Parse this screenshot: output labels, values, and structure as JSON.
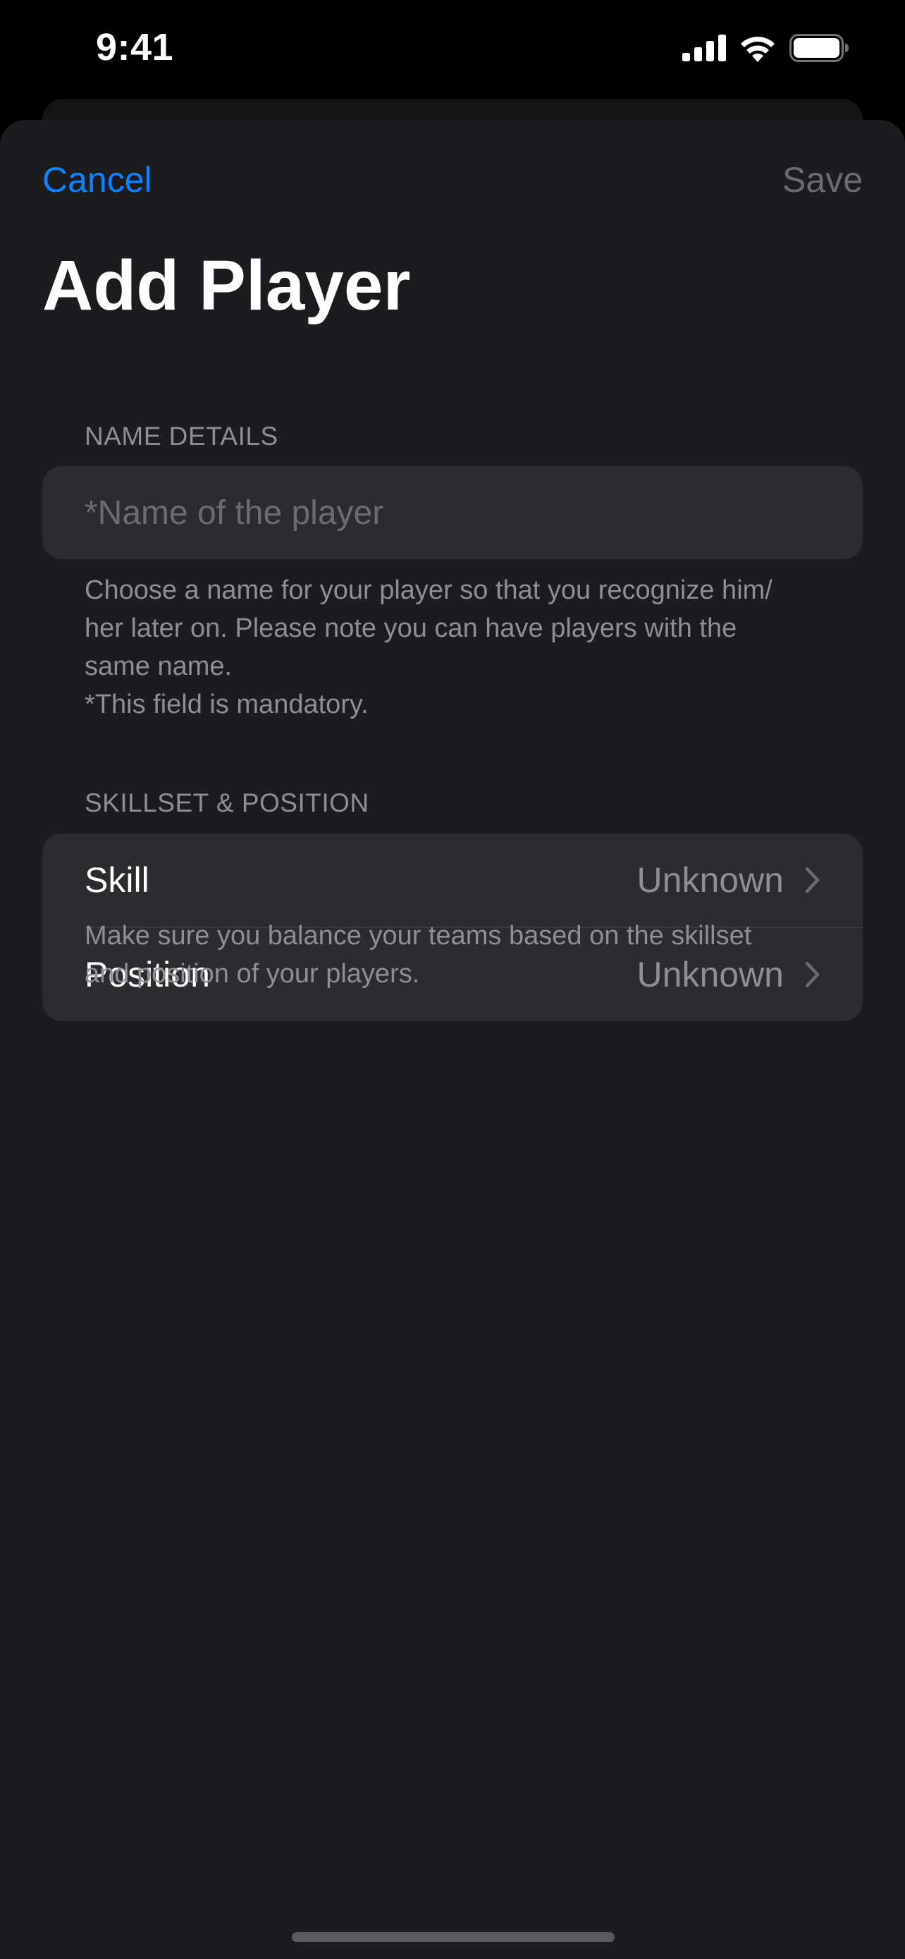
{
  "status_bar": {
    "time": "9:41"
  },
  "nav": {
    "cancel_label": "Cancel",
    "save_label": "Save"
  },
  "page": {
    "title": "Add Player"
  },
  "name_section": {
    "header": "NAME DETAILS",
    "input_placeholder": "*Name of the player",
    "input_value": "",
    "footer_lines": [
      "Choose a name for your player so that you recognize him/",
      "her later on. Please note you can have players with the",
      "same name.",
      "*This field is mandatory."
    ]
  },
  "skill_section": {
    "header": "SKILLSET & POSITION",
    "rows": [
      {
        "label": "Skill",
        "value": "Unknown"
      },
      {
        "label": "Position",
        "value": "Unknown"
      }
    ],
    "footer_lines": [
      "Make sure you balance your teams based on the skillset",
      "and position of your players."
    ]
  },
  "colors": {
    "accent": "#0a84ff",
    "background": "#1c1c1e",
    "card": "#2c2c2e",
    "secondary_text": "#8e8e93",
    "disabled_text": "#6b6b70"
  },
  "icons": {
    "signal": "cellular-signal-icon",
    "wifi": "wifi-icon",
    "battery": "battery-icon",
    "chevron": "chevron-right-icon"
  }
}
